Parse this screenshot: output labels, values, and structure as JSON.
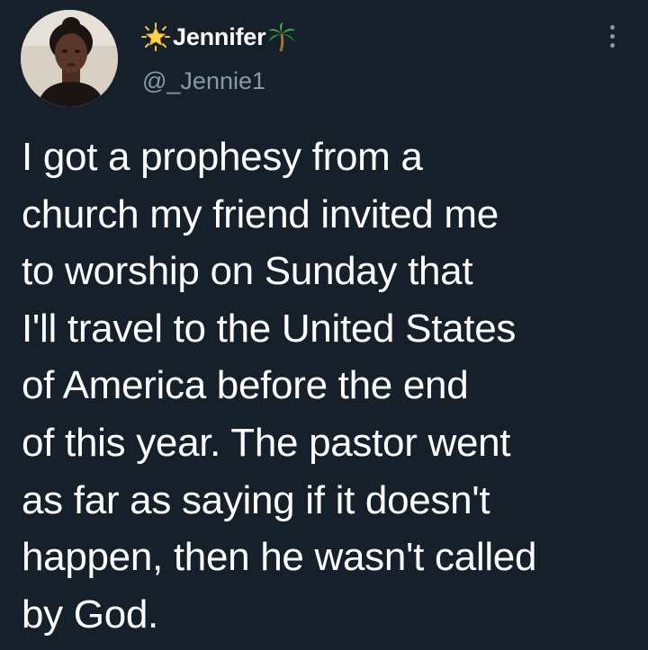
{
  "author": {
    "display_name": "Jennifer",
    "name_prefix_emoji": "glowing-star-icon",
    "name_suffix_emoji": "palm-tree-icon",
    "handle": "@_Jennie1",
    "avatar": "avatar"
  },
  "tweet": {
    "text": "I got a prophesy from a\nchurch my friend invited me\nto worship on Sunday that\nI'll travel to the United States\nof America before the end\nof this year. The pastor went\nas far as saying if it doesn't\nhappen, then he wasn't called\nby God."
  },
  "actions": {
    "more_icon": "more-vertical-icon"
  },
  "colors": {
    "background": "#15202b",
    "primary_text": "#ffffff",
    "secondary_text": "#8899a6"
  }
}
